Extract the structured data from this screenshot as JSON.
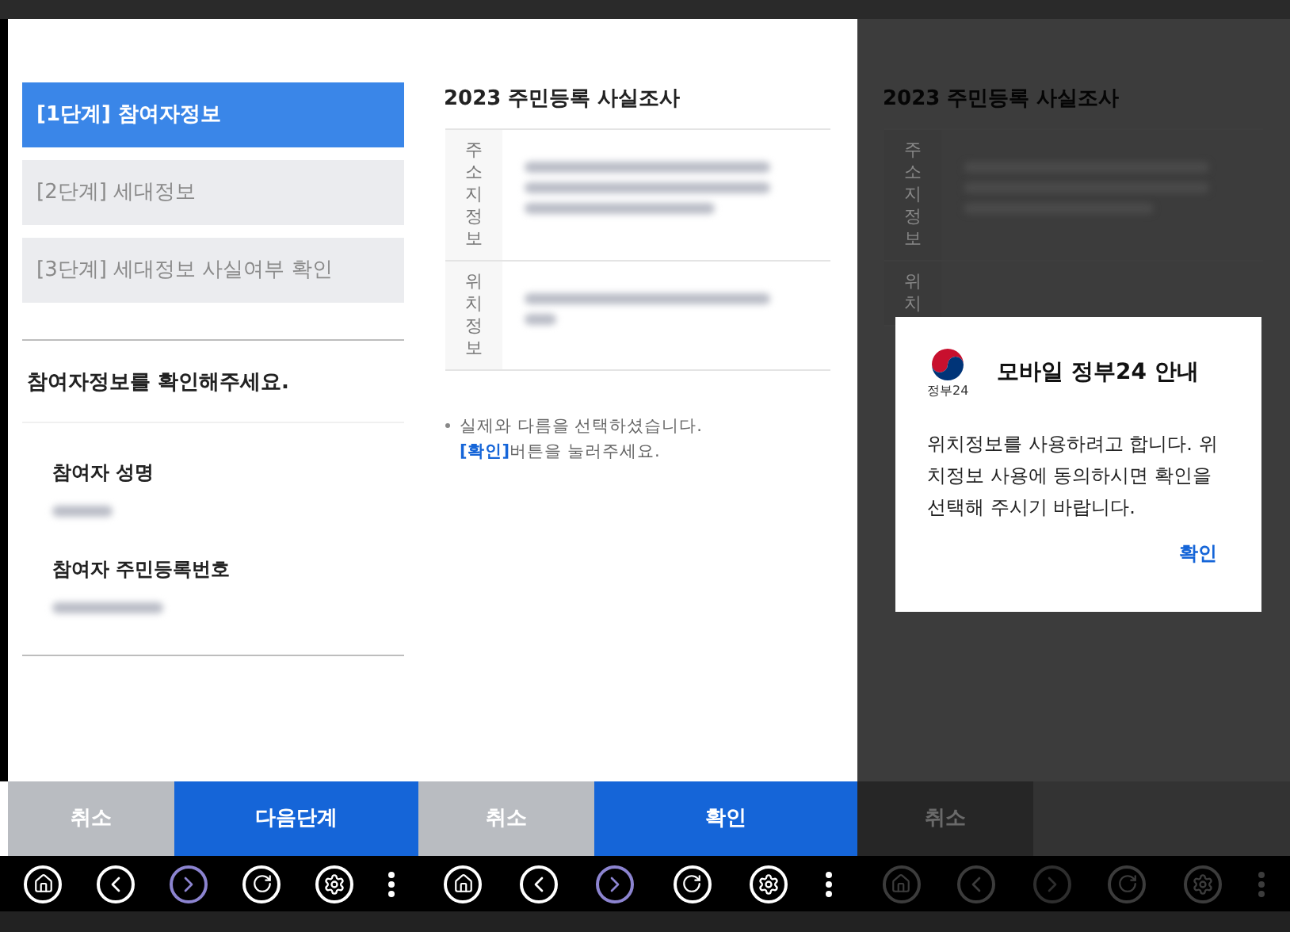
{
  "step_panel": {
    "steps": [
      {
        "label": "[1단계] 참여자정보",
        "selected": true
      },
      {
        "label": "[2단계] 세대정보",
        "selected": false
      },
      {
        "label": "[3단계] 세대정보 사실여부 확인",
        "selected": false
      }
    ],
    "heading": "참여자정보를 확인해주세요.",
    "fields": [
      {
        "label": "참여자 성명"
      },
      {
        "label": "참여자 주민등록번호"
      }
    ],
    "buttons": [
      {
        "label": "취소",
        "kind": "secondary"
      },
      {
        "label": "다음단계",
        "kind": "primary"
      }
    ]
  },
  "survey_panel": {
    "title": "2023 주민등록 사실조사",
    "rows": [
      {
        "label": "주소지정보"
      },
      {
        "label": "위치정보"
      }
    ],
    "note": {
      "text": "실제와 다름을 선택하셨습니다.",
      "highlight": "[확인]",
      "rest": "버튼을 눌러주세요."
    },
    "buttons": [
      {
        "label": "취소",
        "kind": "secondary"
      },
      {
        "label": "확인",
        "kind": "primary"
      }
    ]
  },
  "dimmed_panel": {
    "title": "2023 주민등록 사실조사",
    "rows": [
      {
        "label": "주소지정보"
      },
      {
        "label": "위치"
      }
    ],
    "buttons": [
      {
        "label": "취소",
        "kind": "secondary"
      }
    ],
    "dialog": {
      "logo_text": "정부24",
      "title": "모바일 정부24 안내",
      "message": "위치정보를 사용하려고 합니다. 위치정보 사용에 동의하시면 확인을 선택해 주시기 바랍니다.",
      "button": "확인"
    }
  }
}
